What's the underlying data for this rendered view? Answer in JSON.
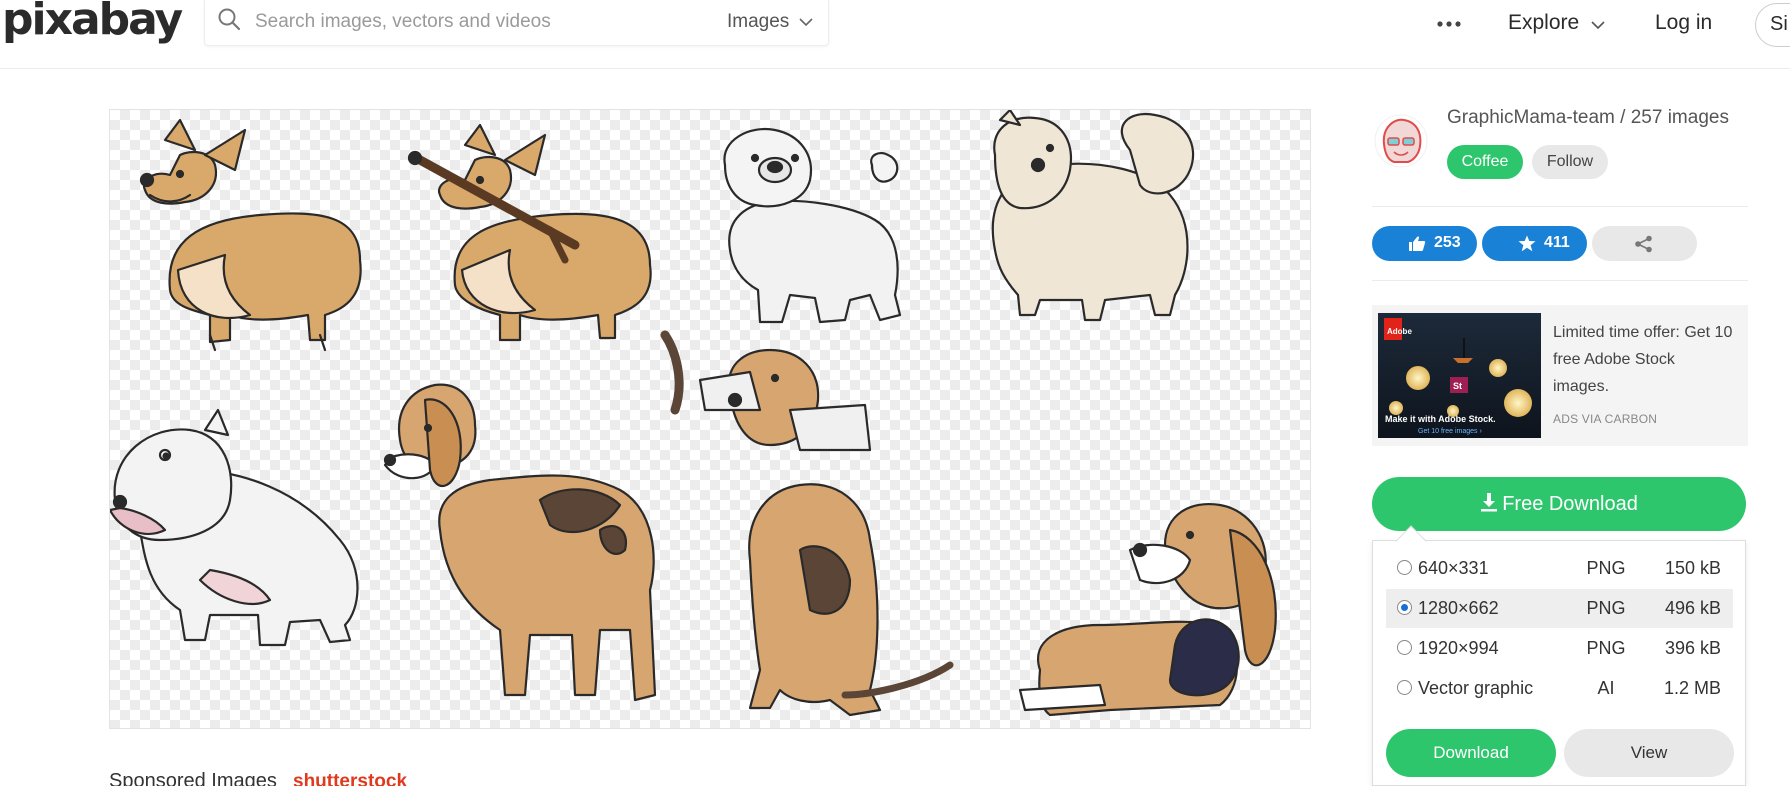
{
  "header": {
    "logo": "pixabay",
    "search_placeholder": "Search images, vectors and videos",
    "search_type": "Images",
    "more_icon": "more-dots-icon",
    "nav_explore": "Explore",
    "nav_login": "Log in",
    "nav_join": "Si"
  },
  "main_image": {
    "alt_subject": "cartoon dogs collection on transparent background"
  },
  "sponsored": {
    "label": "Sponsored Images",
    "brand": "shutterstock"
  },
  "author": {
    "name_line": "GraphicMama-team / 257 images",
    "coffee_label": "Coffee",
    "follow_label": "Follow"
  },
  "actions": {
    "likes": "253",
    "favorites": "411",
    "like_icon": "thumbs-up-icon",
    "fav_icon": "star-icon",
    "share_icon": "share-icon"
  },
  "ad": {
    "text": "Limited time offer: Get 10 free Adobe Stock images.",
    "via": "ADS VIA CARBON",
    "img_brand": "Adobe",
    "img_badge": "St",
    "img_tagline": "Make it with Adobe Stock.",
    "img_cta": "Get 10 free images ›"
  },
  "download": {
    "free_label": "Free Download",
    "options": [
      {
        "size": "640×331",
        "format": "PNG",
        "filesize": "150 kB",
        "selected": false
      },
      {
        "size": "1280×662",
        "format": "PNG",
        "filesize": "496 kB",
        "selected": true
      },
      {
        "size": "1920×994",
        "format": "PNG",
        "filesize": "396 kB",
        "selected": false
      },
      {
        "size": "Vector graphic",
        "format": "AI",
        "filesize": "1.2 MB",
        "selected": false
      }
    ],
    "download_label": "Download",
    "view_label": "View"
  },
  "colors": {
    "green": "#2ec66d",
    "blue": "#1a82d6"
  }
}
